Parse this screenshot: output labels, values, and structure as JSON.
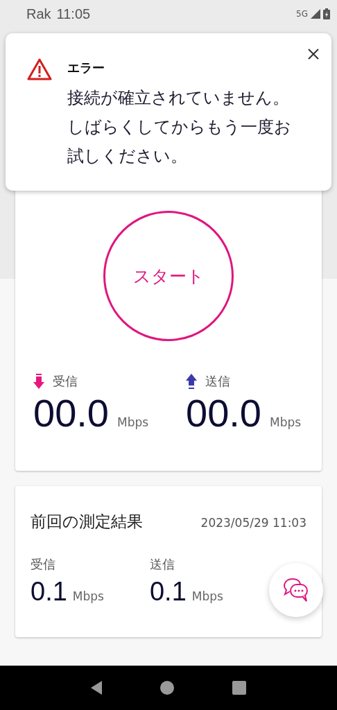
{
  "status_bar": {
    "carrier": "Rak",
    "time": "11:05",
    "network": "5G"
  },
  "error_dialog": {
    "title": "エラー",
    "message": "接続が確立されていません。しばらくしてからもう一度お試しください。"
  },
  "speed_test": {
    "start_button": "スタート",
    "metrics": [
      {
        "kind": "download",
        "label": "受信",
        "value": "00.0",
        "unit": "Mbps"
      },
      {
        "kind": "upload",
        "label": "送信",
        "value": "00.0",
        "unit": "Mbps"
      }
    ]
  },
  "last_result": {
    "title": "前回の測定結果",
    "timestamp": "2023/05/29 11:03",
    "metrics": [
      {
        "label": "受信",
        "value": "0.1",
        "unit": "Mbps"
      },
      {
        "label": "送信",
        "value": "0.1",
        "unit": "Mbps"
      }
    ]
  }
}
